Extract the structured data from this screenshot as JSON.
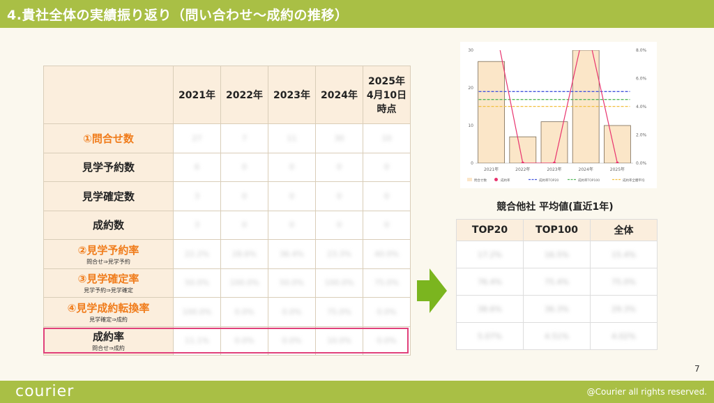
{
  "title": "4.貴社全体の実績振り返り（問い合わせ〜成約の推移）",
  "page_number": "7",
  "footer": {
    "logo": "courier",
    "copyright": "@Courier all rights reserved."
  },
  "main_table": {
    "headers": [
      "2021年",
      "2022年",
      "2023年",
      "2024年",
      "2025年\n4月10日\n時点"
    ],
    "rows": [
      {
        "label": "①問合せ数",
        "sub": "",
        "accent": true,
        "values": [
          "27",
          "7",
          "11",
          "30",
          "10"
        ]
      },
      {
        "label": "見学予約数",
        "sub": "",
        "accent": false,
        "values": [
          "6",
          "0",
          "0",
          "0",
          "0"
        ]
      },
      {
        "label": "見学確定数",
        "sub": "",
        "accent": false,
        "values": [
          "3",
          "0",
          "0",
          "0",
          "0"
        ]
      },
      {
        "label": "成約数",
        "sub": "",
        "accent": false,
        "values": [
          "3",
          "0",
          "0",
          "0",
          "0"
        ]
      },
      {
        "label": "②見学予約率",
        "sub": "問合せ⇒見学予約",
        "accent": true,
        "values": [
          "22.2%",
          "28.6%",
          "36.4%",
          "23.3%",
          "40.0%"
        ]
      },
      {
        "label": "③見学確定率",
        "sub": "見学予約⇒見学確定",
        "accent": true,
        "values": [
          "50.0%",
          "100.0%",
          "50.0%",
          "100.0%",
          "75.0%"
        ]
      },
      {
        "label": "④見学成約転換率",
        "sub": "見学確定⇒成約",
        "accent": true,
        "values": [
          "100.0%",
          "0.0%",
          "0.0%",
          "75.0%",
          "0.0%"
        ]
      },
      {
        "label": "成約率",
        "sub": "問合せ⇒成約",
        "accent": false,
        "values": [
          "11.1%",
          "0.0%",
          "0.0%",
          "10.0%",
          "0.0%"
        ]
      }
    ]
  },
  "chart_data": {
    "type": "bar",
    "categories": [
      "2021年",
      "2022年",
      "2023年",
      "2024年",
      "2025年"
    ],
    "series": [
      {
        "name": "問合せ数",
        "kind": "bar",
        "axis": "left",
        "color": "#fbe6c8",
        "values": [
          27,
          7,
          11,
          30,
          10
        ]
      },
      {
        "name": "成約率",
        "kind": "line",
        "axis": "right",
        "color": "#e8336e",
        "values": [
          11.1,
          0.0,
          0.0,
          10.0,
          0.0
        ]
      },
      {
        "name": "成約率TOP20",
        "kind": "hline",
        "axis": "right",
        "color": "#4455dd",
        "value": 5.07
      },
      {
        "name": "成約率TOP100",
        "kind": "hline",
        "axis": "right",
        "color": "#55b85c",
        "value": 4.51
      },
      {
        "name": "成約率全體平均",
        "kind": "hline",
        "axis": "right",
        "color": "#f2c040",
        "value": 4.02
      }
    ],
    "left_ticks": [
      "0",
      "10",
      "20",
      "30"
    ],
    "right_ticks": [
      "0.0%",
      "2.0%",
      "4.0%",
      "6.0%",
      "8.0%"
    ],
    "ylim_left": [
      0,
      30
    ],
    "ylim_right": [
      0,
      8
    ],
    "legend_position": "bottom"
  },
  "comparison": {
    "title": "競合他社 平均値(直近1年)",
    "headers": [
      "TOP20",
      "TOP100",
      "全体"
    ],
    "rows": [
      [
        "17.2%",
        "16.5%",
        "15.4%"
      ],
      [
        "76.4%",
        "75.4%",
        "75.0%"
      ],
      [
        "38.6%",
        "36.3%",
        "29.3%"
      ],
      [
        "5.07%",
        "4.51%",
        "4.02%"
      ]
    ]
  }
}
